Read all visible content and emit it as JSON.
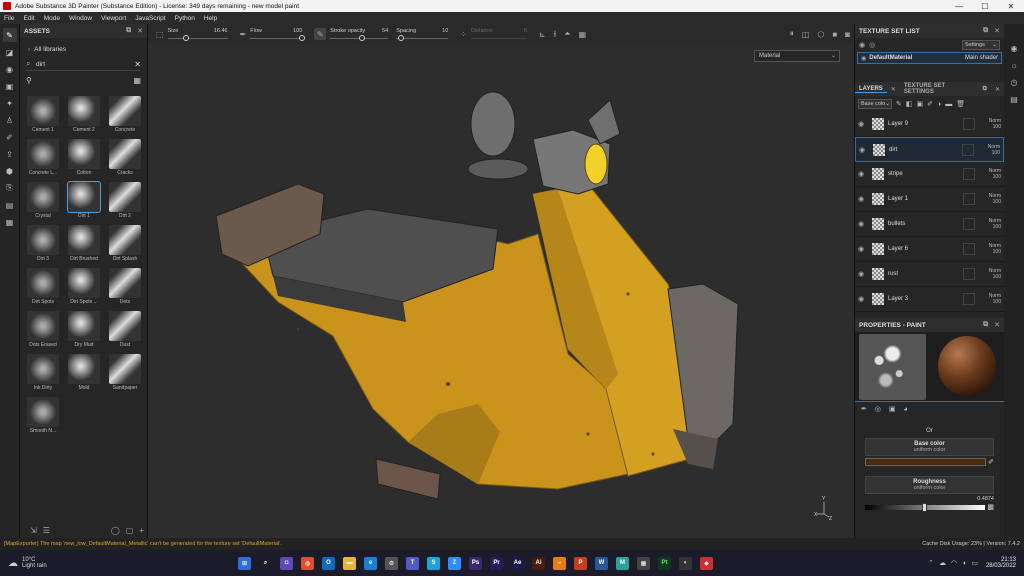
{
  "window": {
    "title": "Adobe Substance 3D Painter (Substance Edition) - License: 349 days remaining - new model paint",
    "minimize": "—",
    "maximize": "☐",
    "close": "✕"
  },
  "menu": [
    "File",
    "Edit",
    "Mode",
    "Window",
    "Viewport",
    "JavaScript",
    "Python",
    "Help"
  ],
  "toolbar": {
    "size_label": "Size",
    "size_value": "16.46",
    "size_fraction": 0.3,
    "flow_label": "Flow",
    "flow_value": "100",
    "flow_fraction": 1.0,
    "stroke_opacity_label": "Stroke opacity",
    "stroke_opacity_value": "54",
    "stroke_opacity_fraction": 0.54,
    "spacing_label": "Spacing",
    "spacing_value": "10",
    "spacing_fraction": 0.1,
    "distance_label": "Distance",
    "distance_value": "6"
  },
  "assets": {
    "title": "ASSETS",
    "libraries": "All libraries",
    "search_value": "dirt",
    "items": [
      {
        "label": "Cement 1"
      },
      {
        "label": "Cement 2"
      },
      {
        "label": "Concrete"
      },
      {
        "label": "Concrete L..."
      },
      {
        "label": "Cotton"
      },
      {
        "label": "Cracks"
      },
      {
        "label": "Crystal"
      },
      {
        "label": "Dirt 1",
        "selected": true
      },
      {
        "label": "Dirt 2"
      },
      {
        "label": "Dirt 3"
      },
      {
        "label": "Dirt Brushed"
      },
      {
        "label": "Dirt Splash"
      },
      {
        "label": "Dirt Spots"
      },
      {
        "label": "Dirt Spots ..."
      },
      {
        "label": "Dots"
      },
      {
        "label": "Dots Erased"
      },
      {
        "label": "Dry Mud"
      },
      {
        "label": "Dust"
      },
      {
        "label": "Ink Dirty"
      },
      {
        "label": "Mold"
      },
      {
        "label": "Sandpaper"
      },
      {
        "label": "Smooth N..."
      }
    ]
  },
  "viewport": {
    "material_mode": "Material",
    "axis_y": "Y",
    "axis_x": "X",
    "axis_z": "Z"
  },
  "texture_set_list": {
    "title": "TEXTURE SET LIST",
    "settings_label": "Settings",
    "item_name": "DefaultMaterial",
    "item_shader": "Main shader"
  },
  "layers_panel": {
    "tab_layers": "LAYERS",
    "tab_settings": "TEXTURE SET SETTINGS",
    "channel": "Base colo",
    "layers": [
      {
        "name": "Layer 9",
        "blend": "Norm",
        "opacity": "100"
      },
      {
        "name": "dirt",
        "blend": "Norm",
        "opacity": "100",
        "selected": true
      },
      {
        "name": "stripe",
        "blend": "Norm",
        "opacity": "100"
      },
      {
        "name": "Layer 1",
        "blend": "Norm",
        "opacity": "100"
      },
      {
        "name": "bullets",
        "blend": "Norm",
        "opacity": "100"
      },
      {
        "name": "Layer 6",
        "blend": "Norm",
        "opacity": "100"
      },
      {
        "name": "rust",
        "blend": "Norm",
        "opacity": "100"
      },
      {
        "name": "Layer 3",
        "blend": "Norm",
        "opacity": "100"
      }
    ]
  },
  "properties": {
    "title": "PROPERTIES - PAINT",
    "or_label": "Or",
    "base_color_title": "Base color",
    "base_color_sub": "uniform color",
    "base_color_hex": "#4a2a0a",
    "roughness_title": "Roughness",
    "roughness_sub": "uniform color",
    "roughness_value": "0.4874",
    "roughness_fraction": 0.4874
  },
  "statusbar": {
    "warning": "[MapExporter] The map 'new_low_DefaultMaterial_Metallic' can't be generated for the texture set 'DefaultMaterial'.",
    "info": "Cache Disk Usage:  23% | Version: 7.4.2"
  },
  "taskbar": {
    "temperature": "10°C",
    "weather": "Light rain",
    "time": "21:13",
    "date": "28/03/2022"
  }
}
